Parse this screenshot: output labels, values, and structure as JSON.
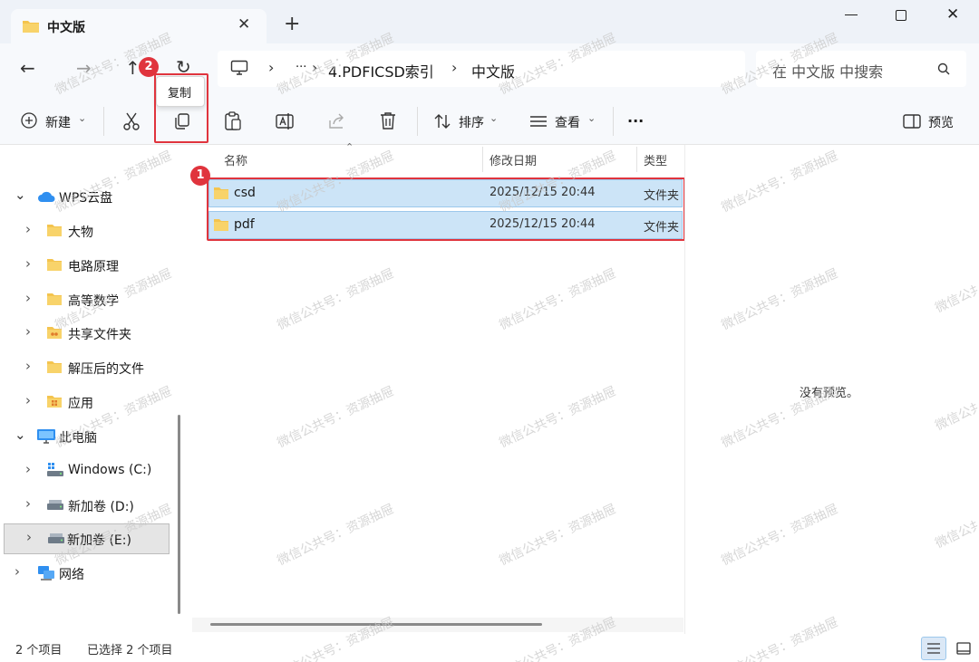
{
  "window": {
    "tab_title": "中文版",
    "new_tab_symbol": "+"
  },
  "nav": {
    "breadcrumb": [
      "4.PDFICSD索引",
      "中文版"
    ],
    "ellipsis": "···",
    "search_placeholder": "在 中文版 中搜索"
  },
  "toolbar": {
    "new_label": "新建",
    "sort_label": "排序",
    "view_label": "查看",
    "more_label": "···",
    "preview_label": "预览",
    "copy_tooltip": "复制"
  },
  "annotations": {
    "badge1": "1",
    "badge2": "2"
  },
  "sidebar": {
    "items": [
      {
        "label": "WPS云盘",
        "icon": "cloud-icon"
      },
      {
        "label": "大物",
        "icon": "folder-icon"
      },
      {
        "label": "电路原理",
        "icon": "folder-icon"
      },
      {
        "label": "高等数学",
        "icon": "folder-icon"
      },
      {
        "label": "共享文件夹",
        "icon": "shared-folder-icon"
      },
      {
        "label": "解压后的文件",
        "icon": "folder-icon"
      },
      {
        "label": "应用",
        "icon": "app-folder-icon"
      },
      {
        "label": "此电脑",
        "icon": "computer-icon"
      },
      {
        "label": "Windows (C:)",
        "icon": "drive-icon"
      },
      {
        "label": "新加卷 (D:)",
        "icon": "drive-icon"
      },
      {
        "label": "新加卷 (E:)",
        "icon": "drive-icon"
      },
      {
        "label": "网络",
        "icon": "network-icon"
      }
    ]
  },
  "columns": {
    "name": "名称",
    "date": "修改日期",
    "type": "类型"
  },
  "files": [
    {
      "name": "csd",
      "date": "2025/12/15 20:44",
      "type": "文件夹"
    },
    {
      "name": "pdf",
      "date": "2025/12/15 20:44",
      "type": "文件夹"
    }
  ],
  "preview": {
    "empty_text": "没有预览。"
  },
  "status": {
    "count": "2 个项目",
    "selected": "已选择 2 个项目"
  },
  "watermark": "微信公共号：资源抽屉",
  "colors": {
    "accent": "#0067c0",
    "selection": "#cce4f7",
    "annotation_red": "#e0343d",
    "folder": "#f4c44e"
  }
}
